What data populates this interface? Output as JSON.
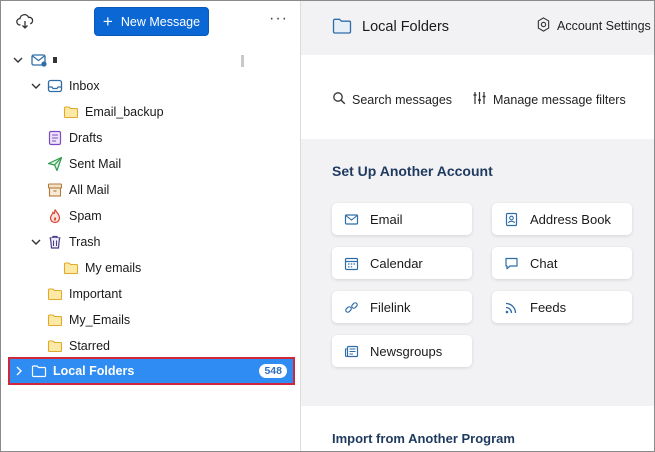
{
  "toolbar": {
    "get_messages_icon": "cloud-download-icon",
    "new_message_label": "New Message",
    "more_icon": "ellipsis-icon",
    "more_label": "···"
  },
  "folders": {
    "account_label": "",
    "inbox": "Inbox",
    "email_backup": "Email_backup",
    "drafts": "Drafts",
    "sent": "Sent Mail",
    "all_mail": "All Mail",
    "spam": "Spam",
    "trash": "Trash",
    "my_emails": "My emails",
    "important": "Important",
    "my_emails2": "My_Emails",
    "starred": "Starred",
    "local_folders": "Local Folders",
    "local_folders_count": "548"
  },
  "header": {
    "title": "Local Folders",
    "account_settings": "Account Settings"
  },
  "tools": {
    "search": "Search messages",
    "filters": "Manage message filters"
  },
  "setup": {
    "title": "Set Up Another Account",
    "cards": {
      "email": "Email",
      "address_book": "Address Book",
      "calendar": "Calendar",
      "chat": "Chat",
      "filelink": "Filelink",
      "feeds": "Feeds",
      "newsgroups": "Newsgroups"
    }
  },
  "import": {
    "title": "Import from Another Program"
  },
  "colors": {
    "primary_button": "#0a67d4",
    "selected_row": "#2f8cf3",
    "selection_outline": "#d0283a",
    "heading": "#1f3a5f",
    "folder_yellow": "#f5c542"
  }
}
